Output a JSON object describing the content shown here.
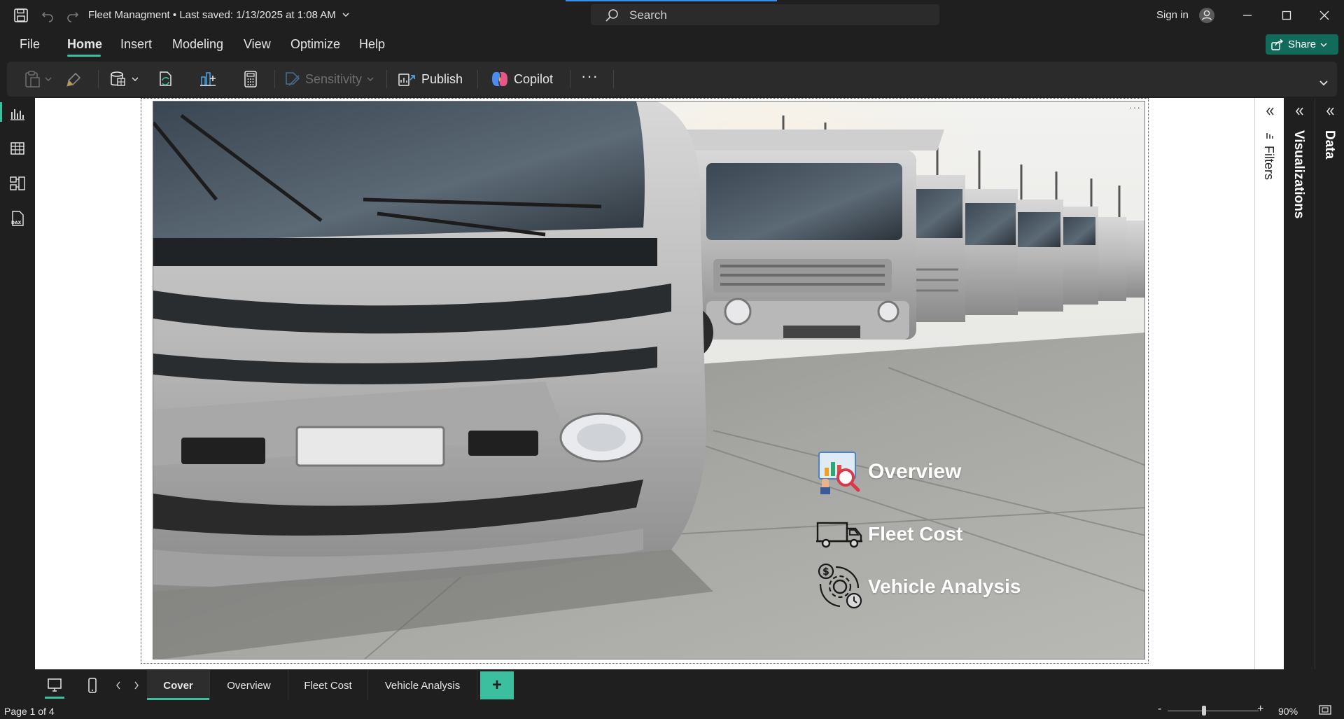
{
  "titlebar": {
    "doc_title": "Fleet Managment • Last saved: 1/13/2025 at 1:08 AM",
    "search_placeholder": "Search",
    "signin_label": "Sign in"
  },
  "menu": {
    "items": [
      "File",
      "Home",
      "Insert",
      "Modeling",
      "View",
      "Optimize",
      "Help"
    ],
    "active": "Home",
    "share_label": "Share"
  },
  "ribbon": {
    "sensitivity_label": "Sensitivity",
    "publish_label": "Publish",
    "copilot_label": "Copilot",
    "more_label": "···"
  },
  "canvas": {
    "more_dots": "···",
    "nav": {
      "overview_label": "Overview",
      "fleet_cost_label": "Fleet Cost",
      "vehicle_analysis_label": "Vehicle Analysis"
    }
  },
  "panes": {
    "filters_label": "Filters",
    "visualizations_label": "Visualizations",
    "data_label": "Data"
  },
  "pages": {
    "tabs": [
      "Cover",
      "Overview",
      "Fleet Cost",
      "Vehicle Analysis"
    ],
    "active": "Cover",
    "add_label": "+"
  },
  "status": {
    "page_count": "Page 1 of 4",
    "zoom_minus": "-",
    "zoom_plus": "+",
    "zoom_level": "90%"
  },
  "colors": {
    "accent": "#3bbf9f",
    "share_bg": "#126b5a",
    "chrome": "#1f1f1f"
  }
}
